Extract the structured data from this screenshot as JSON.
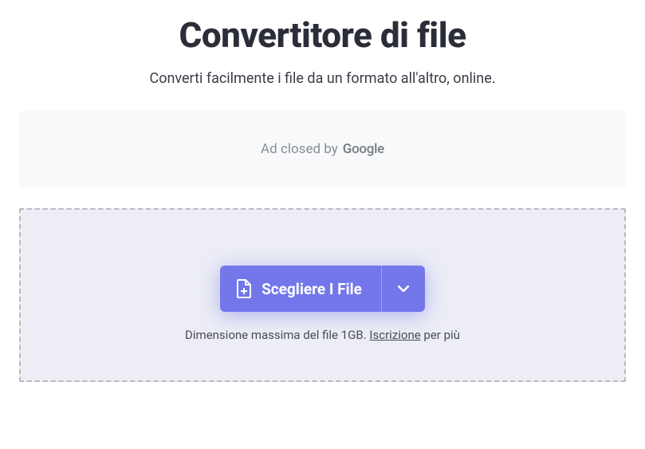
{
  "header": {
    "title": "Convertitore di file",
    "subtitle": "Converti facilmente i file da un formato all'altro, online."
  },
  "ad": {
    "prefix": "Ad closed by ",
    "brand": "Google"
  },
  "dropzone": {
    "choose_label": "Scegliere I File",
    "size_prefix": "Dimensione massima del file 1GB. ",
    "signup_label": "Iscrizione",
    "size_suffix": " per più"
  }
}
